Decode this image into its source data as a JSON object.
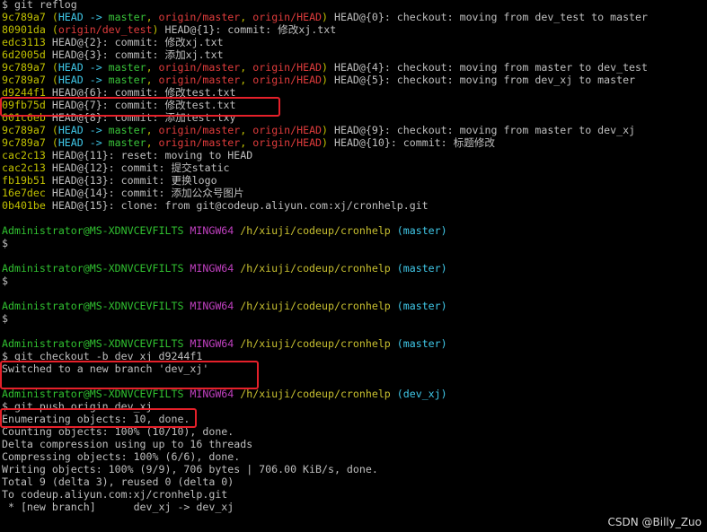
{
  "window": {
    "app": "MINGW64 terminal (Git Bash)"
  },
  "colors": {
    "text": "#bfbfbf",
    "hash": "#c0c000",
    "head": "#40c8e8",
    "branch": "#39c239",
    "remote": "#e03c3c",
    "user": "#30c030",
    "mingw": "#c040c0",
    "path": "#c8c030",
    "highlight": "#e5202a"
  },
  "lines": [
    [
      {
        "t": "$ git reflog",
        "c": "#bfbfbf"
      }
    ],
    [
      {
        "t": "9c789a7 ",
        "c": "#c0c000"
      },
      {
        "t": "(",
        "c": "#c0c000"
      },
      {
        "t": "HEAD -> ",
        "c": "#40c8e8"
      },
      {
        "t": "master",
        "c": "#39c239"
      },
      {
        "t": ", ",
        "c": "#c0c000"
      },
      {
        "t": "origin/master",
        "c": "#e03c3c"
      },
      {
        "t": ", ",
        "c": "#c0c000"
      },
      {
        "t": "origin/HEAD",
        "c": "#e03c3c"
      },
      {
        "t": ")",
        "c": "#c0c000"
      },
      {
        "t": " HEAD@{0}: checkout: moving from dev_test to master",
        "c": "#bfbfbf"
      }
    ],
    [
      {
        "t": "80901da ",
        "c": "#c0c000"
      },
      {
        "t": "(",
        "c": "#c0c000"
      },
      {
        "t": "origin/dev_test",
        "c": "#e03c3c"
      },
      {
        "t": ")",
        "c": "#c0c000"
      },
      {
        "t": " HEAD@{1}: commit: 修改xj.txt",
        "c": "#bfbfbf"
      }
    ],
    [
      {
        "t": "edc3113 ",
        "c": "#c0c000"
      },
      {
        "t": "HEAD@{2}: commit: 修改xj.txt",
        "c": "#bfbfbf"
      }
    ],
    [
      {
        "t": "6d2005d ",
        "c": "#c0c000"
      },
      {
        "t": "HEAD@{3}: commit: 添加xj.txt",
        "c": "#bfbfbf"
      }
    ],
    [
      {
        "t": "9c789a7 ",
        "c": "#c0c000"
      },
      {
        "t": "(",
        "c": "#c0c000"
      },
      {
        "t": "HEAD -> ",
        "c": "#40c8e8"
      },
      {
        "t": "master",
        "c": "#39c239"
      },
      {
        "t": ", ",
        "c": "#c0c000"
      },
      {
        "t": "origin/master",
        "c": "#e03c3c"
      },
      {
        "t": ", ",
        "c": "#c0c000"
      },
      {
        "t": "origin/HEAD",
        "c": "#e03c3c"
      },
      {
        "t": ")",
        "c": "#c0c000"
      },
      {
        "t": " HEAD@{4}: checkout: moving from master to dev_test",
        "c": "#bfbfbf"
      }
    ],
    [
      {
        "t": "9c789a7 ",
        "c": "#c0c000"
      },
      {
        "t": "(",
        "c": "#c0c000"
      },
      {
        "t": "HEAD -> ",
        "c": "#40c8e8"
      },
      {
        "t": "master",
        "c": "#39c239"
      },
      {
        "t": ", ",
        "c": "#c0c000"
      },
      {
        "t": "origin/master",
        "c": "#e03c3c"
      },
      {
        "t": ", ",
        "c": "#c0c000"
      },
      {
        "t": "origin/HEAD",
        "c": "#e03c3c"
      },
      {
        "t": ")",
        "c": "#c0c000"
      },
      {
        "t": " HEAD@{5}: checkout: moving from dev_xj to master",
        "c": "#bfbfbf"
      }
    ],
    [
      {
        "t": "d9244f1 ",
        "c": "#c0c000"
      },
      {
        "t": "HEAD@{6}: commit: 修改test.txt",
        "c": "#bfbfbf"
      }
    ],
    [
      {
        "t": "09fb75d ",
        "c": "#c0c000"
      },
      {
        "t": "HEAD@{7}: commit: 修改test.txt",
        "c": "#bfbfbf"
      }
    ],
    [
      {
        "t": "601c6eb ",
        "c": "#c0c000"
      },
      {
        "t": "HEAD@{8}: commit: 添加test.txy",
        "c": "#bfbfbf"
      }
    ],
    [
      {
        "t": "9c789a7 ",
        "c": "#c0c000"
      },
      {
        "t": "(",
        "c": "#c0c000"
      },
      {
        "t": "HEAD -> ",
        "c": "#40c8e8"
      },
      {
        "t": "master",
        "c": "#39c239"
      },
      {
        "t": ", ",
        "c": "#c0c000"
      },
      {
        "t": "origin/master",
        "c": "#e03c3c"
      },
      {
        "t": ", ",
        "c": "#c0c000"
      },
      {
        "t": "origin/HEAD",
        "c": "#e03c3c"
      },
      {
        "t": ")",
        "c": "#c0c000"
      },
      {
        "t": " HEAD@{9}: checkout: moving from master to dev_xj",
        "c": "#bfbfbf"
      }
    ],
    [
      {
        "t": "9c789a7 ",
        "c": "#c0c000"
      },
      {
        "t": "(",
        "c": "#c0c000"
      },
      {
        "t": "HEAD -> ",
        "c": "#40c8e8"
      },
      {
        "t": "master",
        "c": "#39c239"
      },
      {
        "t": ", ",
        "c": "#c0c000"
      },
      {
        "t": "origin/master",
        "c": "#e03c3c"
      },
      {
        "t": ", ",
        "c": "#c0c000"
      },
      {
        "t": "origin/HEAD",
        "c": "#e03c3c"
      },
      {
        "t": ")",
        "c": "#c0c000"
      },
      {
        "t": " HEAD@{10}: commit: 标题修改",
        "c": "#bfbfbf"
      }
    ],
    [
      {
        "t": "cac2c13 ",
        "c": "#c0c000"
      },
      {
        "t": "HEAD@{11}: reset: moving to HEAD",
        "c": "#bfbfbf"
      }
    ],
    [
      {
        "t": "cac2c13 ",
        "c": "#c0c000"
      },
      {
        "t": "HEAD@{12}: commit: 提交static",
        "c": "#bfbfbf"
      }
    ],
    [
      {
        "t": "fb19b51 ",
        "c": "#c0c000"
      },
      {
        "t": "HEAD@{13}: commit: 更换logo",
        "c": "#bfbfbf"
      }
    ],
    [
      {
        "t": "16e7dec ",
        "c": "#c0c000"
      },
      {
        "t": "HEAD@{14}: commit: 添加公众号图片",
        "c": "#bfbfbf"
      }
    ],
    [
      {
        "t": "0b401be ",
        "c": "#c0c000"
      },
      {
        "t": "HEAD@{15}: clone: from git@codeup.aliyun.com:xj/cronhelp.git",
        "c": "#bfbfbf"
      }
    ],
    [],
    [
      {
        "t": "Administrator@MS-XDNVCEVFILTS",
        "c": "#30c030"
      },
      {
        "t": " ",
        "c": "#bfbfbf"
      },
      {
        "t": "MINGW64",
        "c": "#c040c0"
      },
      {
        "t": " ",
        "c": "#bfbfbf"
      },
      {
        "t": "/h/xiuji/codeup/cronhelp",
        "c": "#c8c030"
      },
      {
        "t": " ",
        "c": "#bfbfbf"
      },
      {
        "t": "(master)",
        "c": "#40c8e8"
      }
    ],
    [
      {
        "t": "$",
        "c": "#bfbfbf"
      }
    ],
    [],
    [
      {
        "t": "Administrator@MS-XDNVCEVFILTS",
        "c": "#30c030"
      },
      {
        "t": " ",
        "c": "#bfbfbf"
      },
      {
        "t": "MINGW64",
        "c": "#c040c0"
      },
      {
        "t": " ",
        "c": "#bfbfbf"
      },
      {
        "t": "/h/xiuji/codeup/cronhelp",
        "c": "#c8c030"
      },
      {
        "t": " ",
        "c": "#bfbfbf"
      },
      {
        "t": "(master)",
        "c": "#40c8e8"
      }
    ],
    [
      {
        "t": "$",
        "c": "#bfbfbf"
      }
    ],
    [],
    [
      {
        "t": "Administrator@MS-XDNVCEVFILTS",
        "c": "#30c030"
      },
      {
        "t": " ",
        "c": "#bfbfbf"
      },
      {
        "t": "MINGW64",
        "c": "#c040c0"
      },
      {
        "t": " ",
        "c": "#bfbfbf"
      },
      {
        "t": "/h/xiuji/codeup/cronhelp",
        "c": "#c8c030"
      },
      {
        "t": " ",
        "c": "#bfbfbf"
      },
      {
        "t": "(master)",
        "c": "#40c8e8"
      }
    ],
    [
      {
        "t": "$",
        "c": "#bfbfbf"
      }
    ],
    [],
    [
      {
        "t": "Administrator@MS-XDNVCEVFILTS",
        "c": "#30c030"
      },
      {
        "t": " ",
        "c": "#bfbfbf"
      },
      {
        "t": "MINGW64",
        "c": "#c040c0"
      },
      {
        "t": " ",
        "c": "#bfbfbf"
      },
      {
        "t": "/h/xiuji/codeup/cronhelp",
        "c": "#c8c030"
      },
      {
        "t": " ",
        "c": "#bfbfbf"
      },
      {
        "t": "(master)",
        "c": "#40c8e8"
      }
    ],
    [
      {
        "t": "$ git checkout -b dev_xj d9244f1",
        "c": "#bfbfbf"
      }
    ],
    [
      {
        "t": "Switched to a new branch 'dev_xj'",
        "c": "#bfbfbf"
      }
    ],
    [],
    [
      {
        "t": "Administrator@MS-XDNVCEVFILTS",
        "c": "#30c030"
      },
      {
        "t": " ",
        "c": "#bfbfbf"
      },
      {
        "t": "MINGW64",
        "c": "#c040c0"
      },
      {
        "t": " ",
        "c": "#bfbfbf"
      },
      {
        "t": "/h/xiuji/codeup/cronhelp",
        "c": "#c8c030"
      },
      {
        "t": " ",
        "c": "#bfbfbf"
      },
      {
        "t": "(dev_xj)",
        "c": "#40c8e8"
      }
    ],
    [
      {
        "t": "$ git push origin dev_xj",
        "c": "#bfbfbf"
      }
    ],
    [
      {
        "t": "Enumerating objects: 10, done.",
        "c": "#bfbfbf"
      }
    ],
    [
      {
        "t": "Counting objects: 100% (10/10), done.",
        "c": "#bfbfbf"
      }
    ],
    [
      {
        "t": "Delta compression using up to 16 threads",
        "c": "#bfbfbf"
      }
    ],
    [
      {
        "t": "Compressing objects: 100% (6/6), done.",
        "c": "#bfbfbf"
      }
    ],
    [
      {
        "t": "Writing objects: 100% (9/9), 706 bytes | 706.00 KiB/s, done.",
        "c": "#bfbfbf"
      }
    ],
    [
      {
        "t": "Total 9 (delta 3), reused 0 (delta 0)",
        "c": "#bfbfbf"
      }
    ],
    [
      {
        "t": "To codeup.aliyun.com:xj/cronhelp.git",
        "c": "#bfbfbf"
      }
    ],
    [
      {
        "t": " * [new branch]      dev_xj -> dev_xj",
        "c": "#bfbfbf"
      }
    ]
  ],
  "watermark": "CSDN @Billy_Zuo"
}
